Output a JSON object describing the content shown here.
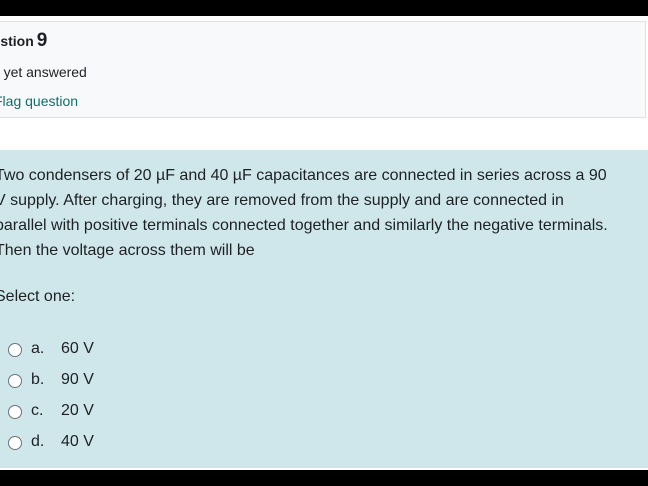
{
  "question": {
    "label": "uestion",
    "number": "9",
    "state": "ot yet answered",
    "flag_label": "Flag question"
  },
  "question_text": {
    "lines": [
      "Two condensers of 20 µF and 40 µF capacitances are connected in series across a 90",
      "V supply. After charging, they are removed from the supply and are connected in",
      "parallel with positive terminals connected together and similarly the negative terminals.",
      "Then the voltage across them will be"
    ]
  },
  "prompt": "Select one:",
  "options": [
    {
      "letter": "a.",
      "text": "60 V",
      "selected": false
    },
    {
      "letter": "b.",
      "text": "90 V",
      "selected": false
    },
    {
      "letter": "c.",
      "text": "20 V",
      "selected": false
    },
    {
      "letter": "d.",
      "text": "40 V",
      "selected": false
    }
  ]
}
